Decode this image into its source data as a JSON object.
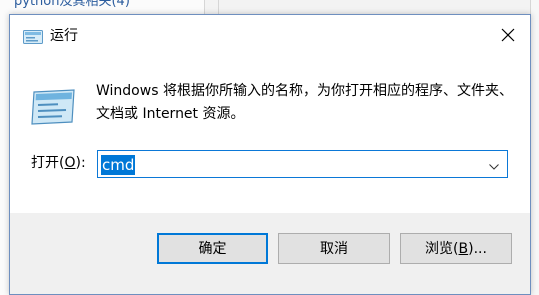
{
  "background": {
    "list_item": "python及其相关(4)"
  },
  "dialog": {
    "title": "运行",
    "description": "Windows 将根据你所输入的名称，为你打开相应的程序、文件夹、文档或 Internet 资源。",
    "open_label_prefix": "打开(",
    "open_label_key": "O",
    "open_label_suffix": "):",
    "input_value": "cmd",
    "buttons": {
      "ok": "确定",
      "cancel": "取消",
      "browse_prefix": "浏览(",
      "browse_key": "B",
      "browse_suffix": ")..."
    }
  },
  "icons": {
    "title": "run-icon",
    "content": "run-large-icon",
    "close": "close-icon",
    "dropdown": "chevron-down-icon"
  },
  "colors": {
    "accent": "#0078d7",
    "dialog_bg": "#f0f0f0",
    "button_bg": "#e1e1e1"
  }
}
